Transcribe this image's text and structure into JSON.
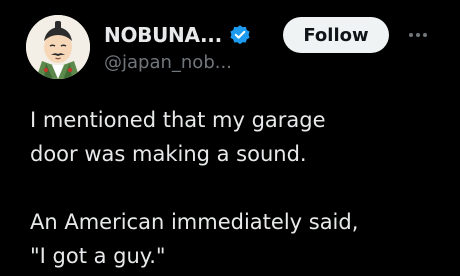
{
  "tweet": {
    "author": {
      "display_name": "NOBUNA...",
      "handle": "@japan_nob...",
      "verified_icon": "verified-badge-icon",
      "avatar": "avatar-illustration"
    },
    "follow_label": "Follow",
    "more_icon": "more-options-icon",
    "body": "I mentioned that my garage\ndoor was making a sound.\n\nAn American immediately said,\n\"I got a guy.\""
  },
  "colors": {
    "background": "#000000",
    "text_primary": "#e7e9ea",
    "text_secondary": "#71767b",
    "verified_blue": "#1d9bf0",
    "button_bg": "#eff3f4",
    "button_text": "#0f1419"
  }
}
